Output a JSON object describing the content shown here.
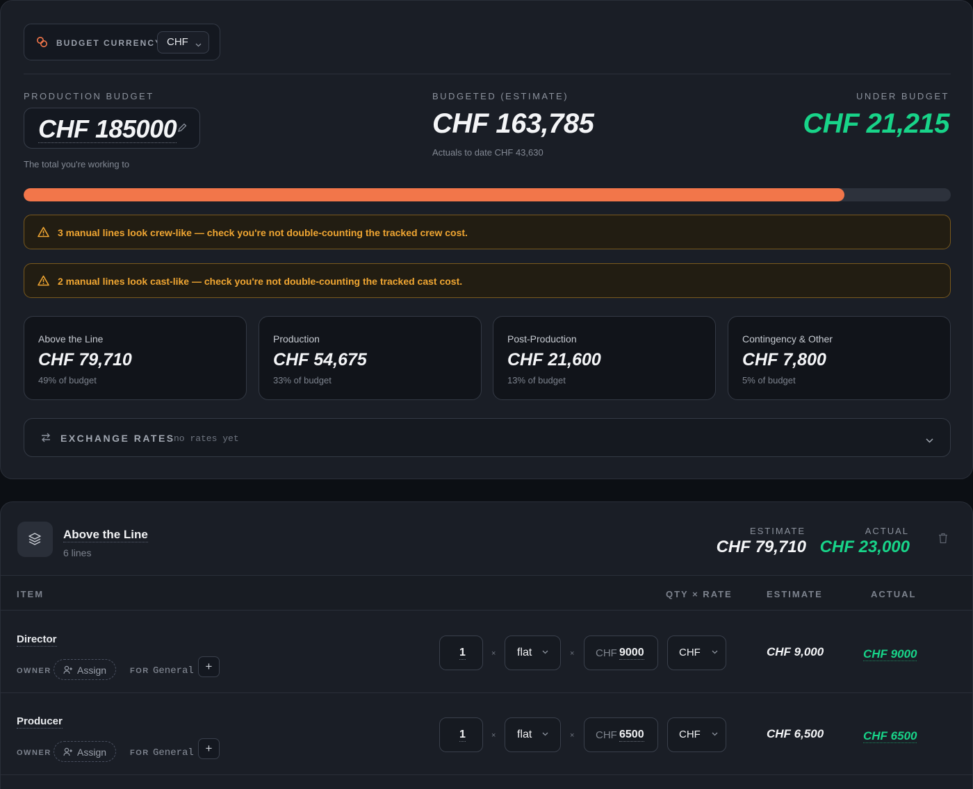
{
  "currency": {
    "label": "BUDGET CURRENCY",
    "selected": "CHF",
    "icon": "coins-icon"
  },
  "summary": {
    "production_budget_label": "PRODUCTION BUDGET",
    "production_budget_value": "CHF 185000",
    "production_budget_hint": "The total you're working to",
    "budgeted_label": "BUDGETED (ESTIMATE)",
    "budgeted_value": "CHF 163,785",
    "actuals_note": "Actuals to date CHF 43,630",
    "under_label": "UNDER BUDGET",
    "under_value": "CHF 21,215",
    "progress_fraction": 0.885,
    "progress_color": "#f2764a",
    "under_color": "#18d489"
  },
  "warnings": [
    {
      "text": "3 manual lines look crew-like — check you're not double-counting the tracked crew cost.",
      "icon": "warning-icon"
    },
    {
      "text": "2 manual lines look cast-like — check you're not double-counting the tracked cast cost.",
      "icon": "warning-icon"
    }
  ],
  "buckets": [
    {
      "name": "Above the Line",
      "value": "CHF 79,710",
      "pct": "49% of budget"
    },
    {
      "name": "Production",
      "value": "CHF 54,675",
      "pct": "33% of budget"
    },
    {
      "name": "Post-Production",
      "value": "CHF 21,600",
      "pct": "13% of budget"
    },
    {
      "name": "Contingency & Other",
      "value": "CHF 7,800",
      "pct": "5% of budget"
    }
  ],
  "exchange": {
    "label": "EXCHANGE RATES",
    "note": "no rates yet",
    "icon": "swap-arrows-icon"
  },
  "category": {
    "icon": "layers-icon",
    "title": "Above the Line",
    "lines": "6 lines",
    "estimate_label": "ESTIMATE",
    "estimate": "CHF 79,710",
    "actual_label": "ACTUAL",
    "actual": "CHF 23,000"
  },
  "columns": {
    "item": "ITEM",
    "qty_rate": "QTY × RATE",
    "estimate": "ESTIMATE",
    "actual": "ACTUAL"
  },
  "rows": [
    {
      "name": "Director",
      "owner_label": "OWNER",
      "assign": "Assign",
      "for_label": "FOR",
      "for_value": "General",
      "plus": "+",
      "qty": "1",
      "times": "×",
      "unit": "flat",
      "rate_cur": "CHF",
      "rate": "9000",
      "ccy": "CHF",
      "estimate": "CHF 9,000",
      "actual": "CHF 9000"
    },
    {
      "name": "Producer",
      "owner_label": "OWNER",
      "assign": "Assign",
      "for_label": "FOR",
      "for_value": "General",
      "plus": "+",
      "qty": "1",
      "times": "×",
      "unit": "flat",
      "rate_cur": "CHF",
      "rate": "6500",
      "ccy": "CHF",
      "estimate": "CHF 6,500",
      "actual": "CHF 6500"
    }
  ]
}
